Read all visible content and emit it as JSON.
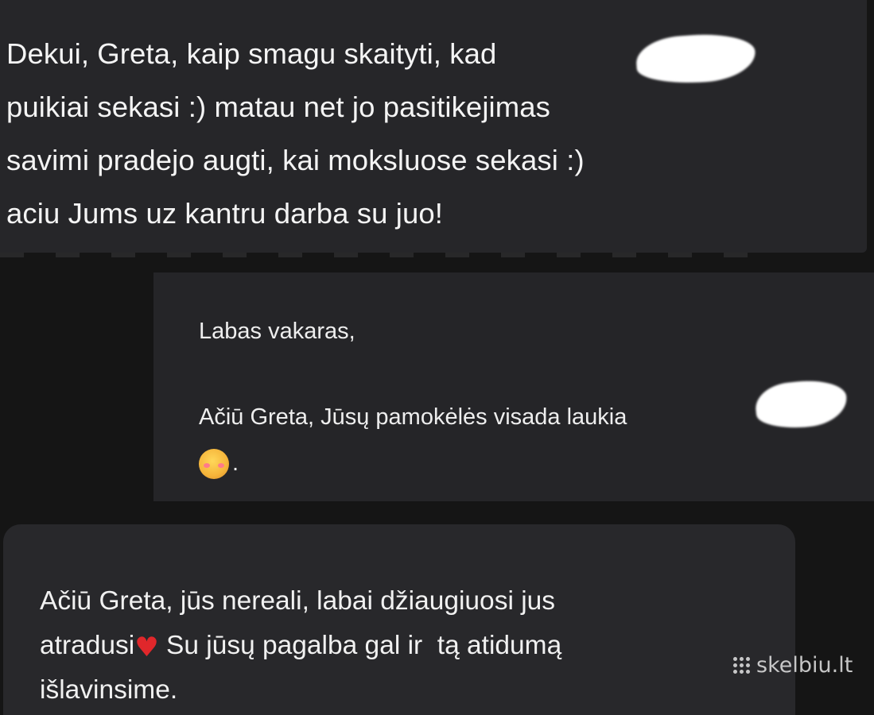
{
  "messages": [
    {
      "lines": [
        "Dekui, Greta, kaip smagu skaityti, kad",
        "puikiai sekasi :) matau net jo pasitikejimas",
        "savimi pradejo augti, kai moksluose sekasi :)",
        "aciu Jums uz kantru darba su juo!"
      ]
    },
    {
      "greeting": "Labas vakaras,",
      "body": "Ačiū Greta, Jūsų pamokėlės visada laukia",
      "emoji_icon": "smiling-face-with-hearts-icon",
      "tail": "."
    },
    {
      "line1": "Ačiū Greta, jūs nereali, labai džiaugiuosi jus",
      "line2_a": "atradusi",
      "heart_icon": "red-heart-icon",
      "line2_b": " Su jūsų pagalba gal ir  tą atidumą",
      "line3": "išlavinsime."
    }
  ],
  "watermark": {
    "text": "skelbiu.lt"
  },
  "colors": {
    "background": "#151515",
    "bubble": "#262629",
    "text": "#f2f2f2",
    "heart": "#e0272b",
    "redaction": "#ffffff"
  }
}
